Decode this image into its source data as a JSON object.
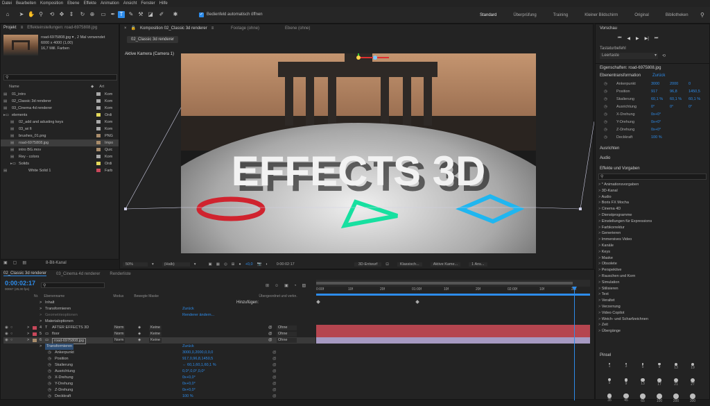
{
  "menu": [
    "Datei",
    "Bearbeiten",
    "Komposition",
    "Ebene",
    "Effekte",
    "Animation",
    "Ansicht",
    "Fenster",
    "Hilfe"
  ],
  "toolbar": {
    "auto_open_label": "Bedienfeld automatisch öffnen"
  },
  "workspaces": [
    "Standard",
    "Überprüfung",
    "Training",
    "Kleiner Bildschirm",
    "Original",
    "Bibliotheken"
  ],
  "project": {
    "tab_label": "Projekt",
    "effects_tab": "Effekteinstellungen: road-6975808.jpg",
    "thumb_name": "road-6975808.jpg ▾ , 2 Mal verwendet",
    "thumb_size": "6000 x 4000 (1,00)",
    "thumb_colors": "16,7 Mill. Farben",
    "col_name": "Name",
    "col_type": "Art",
    "items": [
      {
        "name": "01_intro",
        "type": "Kom",
        "color": "#a9a9a9",
        "icon": "comp"
      },
      {
        "name": "02_Classic 3d renderer",
        "type": "Kom",
        "color": "#a9a9a9",
        "icon": "comp"
      },
      {
        "name": "03_Cinema 4d renderer",
        "type": "Kom",
        "color": "#a9a9a9",
        "icon": "comp"
      },
      {
        "name": "elements",
        "type": "Ordi",
        "color": "#e3d85b",
        "icon": "folder"
      },
      {
        "name": "02_add and adusting keys",
        "type": "Kom",
        "color": "#a9a9a9",
        "icon": "comp"
      },
      {
        "name": "03_wi fi",
        "type": "Kom",
        "color": "#a9a9a9",
        "icon": "comp"
      },
      {
        "name": "brushes_01.png",
        "type": "PNG",
        "color": "#a98c6b",
        "icon": "file"
      },
      {
        "name": "road-6975808.jpg",
        "type": "Impo",
        "color": "#a98c6b",
        "icon": "file"
      },
      {
        "name": "intro BG.mov",
        "type": "Quic",
        "color": "#a98c6b",
        "icon": "file"
      },
      {
        "name": "Rey - colors",
        "type": "Kom",
        "color": "#a9a9a9",
        "icon": "comp"
      },
      {
        "name": "Solids",
        "type": "Ordi",
        "color": "#e3d85b",
        "icon": "folder"
      },
      {
        "name": "White Solid 1",
        "type": "Farb",
        "color": "#c9475a",
        "icon": "file"
      }
    ],
    "bpc": "8-Bit-Kanal"
  },
  "comp": {
    "tab_comp": "Komposition 02_Classic 3d renderer",
    "tab_footage": "Footage (ohne)",
    "tab_layer": "Ebene (ohne)",
    "breadcrumb": "02_Classic 3d renderer",
    "camera_label": "Aktive Kamera (Camera 1)",
    "hero_text": "EFFECTS 3D",
    "zoom": "50%",
    "quality": "(Halb)",
    "exposure": "+0,0",
    "time": "0:00:02:17",
    "renderer": "3D-Entwurf",
    "renderer_mode": "Klassisch...",
    "camera_select": "Aktive Kame...",
    "views": "1 Ans..."
  },
  "preview": {
    "title": "Vorschau",
    "shortcut_label": "Tastaturbefehl",
    "shortcut_value": "Leertaste"
  },
  "properties": {
    "title": "Eigenschaften: road-6975808.jpg",
    "section": "Ebenentransformation",
    "reset": "Zurück",
    "rows": [
      {
        "label": "Ankerpunkt",
        "v1": "3000",
        "v2": "2000",
        "v3": "0"
      },
      {
        "label": "Position",
        "v1": "917",
        "v2": "96,8",
        "v3": "1450,5"
      },
      {
        "label": "Skalierung",
        "v1": "60,1 %",
        "v2": "60,1 %",
        "v3": "60,1 %"
      },
      {
        "label": "Ausrichtung",
        "v1": "0°",
        "v2": "0°",
        "v3": "0°"
      },
      {
        "label": "X-Drehung",
        "v1": "0x+0°",
        "v2": "",
        "v3": ""
      },
      {
        "label": "Y-Drehung",
        "v1": "0x+0°",
        "v2": "",
        "v3": ""
      },
      {
        "label": "Z-Drehung",
        "v1": "0x+0°",
        "v2": "",
        "v3": ""
      },
      {
        "label": "Deckkraft",
        "v1": "100 %",
        "v2": "",
        "v3": ""
      }
    ]
  },
  "side_panels": {
    "align": "Ausrichten",
    "audio": "Audio",
    "effects_presets": "Effekte und Vorgaben",
    "brushes": "Pinsel"
  },
  "effects_list": [
    "* Animationsvorgaben",
    "3D-Kanal",
    "Audio",
    "Boris FX Mocha",
    "Cinema 4D",
    "Dienstprogramme",
    "Einstellungen für Expressions",
    "Farbkorrektur",
    "Generieren",
    "Immersives Video",
    "Kanäle",
    "Keys",
    "Maske",
    "Obsolete",
    "Perspektive",
    "Rauschen und Korn",
    "Simulation",
    "Stilisieren",
    "Text",
    "Veraltet",
    "Verzerrung",
    "Video Copilot",
    "Weich- und Scharfzeichnen",
    "Zeit",
    "Übergänge"
  ],
  "brush_sizes": [
    "1",
    "3",
    "5",
    "9",
    "13",
    "19",
    "5",
    "9",
    "13",
    "17",
    "21",
    "27",
    "35",
    "45",
    "65",
    "100",
    "200",
    "300"
  ],
  "timeline": {
    "tabs": [
      "02_Classic 3d renderer",
      "03_Cinema 4d renderer",
      "Renderliste"
    ],
    "time": "0:00:02:17",
    "frames": "00067 (25,00 fps)",
    "col_nr": "Nr.",
    "col_name": "Ebenenname",
    "col_mode": "Modus",
    "col_mask": "Bewegte Maske",
    "col_parent": "Übergeordnet und verkn.",
    "add_label": "Hinzufügen:",
    "ruler": [
      "0:00f",
      "10f",
      "20f",
      "01:00f",
      "10f",
      "20f",
      "02:00f",
      "10f",
      "20f"
    ],
    "rows": [
      {
        "indent": 1,
        "text": "Inhalt",
        "kind": "prop"
      },
      {
        "indent": 1,
        "text": "Transformieren",
        "kind": "prop",
        "value": "Zurück"
      },
      {
        "indent": 1,
        "text": "Geometrieoptionen",
        "kind": "dim",
        "value": "Renderer ändern..."
      },
      {
        "indent": 1,
        "text": "Materialoptionen",
        "kind": "prop"
      },
      {
        "indent": 0,
        "text": "AFTER EFFECTS 3D",
        "kind": "layer",
        "nr": "4",
        "color": "#c9475a",
        "mode": "Norm",
        "mask": "Keine",
        "parent": "Ohne"
      },
      {
        "indent": 0,
        "text": "floor",
        "kind": "layer",
        "nr": "5",
        "color": "#c9475a",
        "mode": "Norm",
        "mask": "Keine",
        "parent": "Ohne"
      },
      {
        "indent": 0,
        "text": "road-6975808.jpg",
        "kind": "layer",
        "nr": "6",
        "color": "#a98c6b",
        "mode": "Norm",
        "mask": "Keine",
        "parent": "Ohne",
        "selected": true
      },
      {
        "indent": 1,
        "text": "Transformieren",
        "kind": "prop",
        "value": "Zurück"
      },
      {
        "indent": 2,
        "text": "Ankerpunkt",
        "kind": "prop",
        "value": "3000,0,2000,0,0,0"
      },
      {
        "indent": 2,
        "text": "Position",
        "kind": "prop",
        "value": "917,0,96,8,1450,5"
      },
      {
        "indent": 2,
        "text": "Skalierung",
        "kind": "prop",
        "value": "⇔ 60,1,60,1,60,1 %"
      },
      {
        "indent": 2,
        "text": "Ausrichtung",
        "kind": "prop",
        "value": "0,0°,0,0°,0,0°"
      },
      {
        "indent": 2,
        "text": "X-Drehung",
        "kind": "prop",
        "value": "0x+0,0°"
      },
      {
        "indent": 2,
        "text": "Y-Drehung",
        "kind": "prop",
        "value": "0x+0,0°"
      },
      {
        "indent": 2,
        "text": "Z-Drehung",
        "kind": "prop",
        "value": "0x+0,0°"
      },
      {
        "indent": 2,
        "text": "Deckkraft",
        "kind": "prop",
        "value": "100 %"
      }
    ]
  },
  "colors": {
    "accent": "#2d8ceb",
    "red_ring": "#d0232e",
    "green_tri": "#17e0a0",
    "blue_diamond": "#1fb6f0",
    "sky": "#b6865f",
    "track_red": "#b5454f",
    "track_purple": "#a69ac2"
  }
}
